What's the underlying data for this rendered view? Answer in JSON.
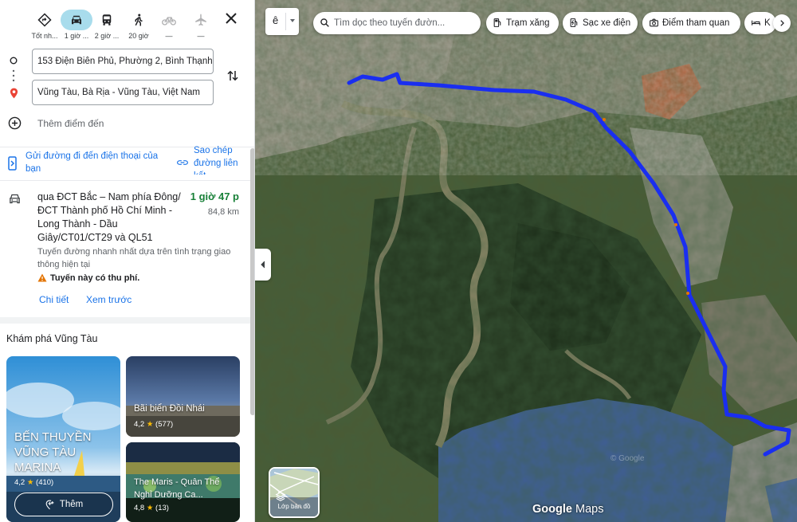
{
  "modes": [
    {
      "name": "best",
      "label": "Tốt nh..."
    },
    {
      "name": "driving",
      "label": "1 giờ ..."
    },
    {
      "name": "transit",
      "label": "2 giờ ..."
    },
    {
      "name": "walking",
      "label": "20 giờ"
    },
    {
      "name": "cycling",
      "label": "—"
    },
    {
      "name": "flight",
      "label": "—"
    }
  ],
  "origin": "153 Điện Biên Phủ, Phường 2, Bình Thạnh,",
  "destination": "Vũng Tàu, Bà Rịa - Vũng Tàu, Việt Nam",
  "add_destination": "Thêm điểm đến",
  "send_to_phone": "Gửi đường đi đến điện thoại của bạn",
  "copy_link": "Sao chép đường liên kết",
  "route": {
    "via": "qua ĐCT Bắc – Nam phía Đông/ĐCT Thành phố Hồ Chí Minh - Long Thành - Dầu Giây/CT01/CT29 và QL51",
    "duration": "1 giờ 47 p",
    "distance": "84,8 km",
    "description": "Tuyến đường nhanh nhất dựa trên tình trạng giao thông hiện tại",
    "toll": "Tuyến này có thu phí.",
    "details": "Chi tiết",
    "preview": "Xem trước"
  },
  "explore": {
    "title": "Khám phá Vũng Tàu",
    "cards": [
      {
        "name": "BẾN THUYỀN VŨNG TÀU MARINA",
        "rating": "4,2",
        "reviews": "(410)"
      },
      {
        "name": "Bãi biển Đồi Nhái",
        "rating": "4,2",
        "reviews": "(577)"
      },
      {
        "name": "The Maris - Quân Thể Nghỉ Dưỡng Ca...",
        "rating": "4,8",
        "reviews": "(13)"
      }
    ],
    "more": "Thêm"
  },
  "map": {
    "menu_letter": "ê",
    "search_placeholder": "Tìm dọc theo tuyến đườn...",
    "chips": [
      "Trạm xăng",
      "Sạc xe điện",
      "Điểm tham quan",
      "K"
    ],
    "layers_label": "Lớp bản đồ",
    "logo_google": "Google",
    "logo_maps": "Maps",
    "watermark": "© Google",
    "route_color": "#1a2ef0"
  }
}
